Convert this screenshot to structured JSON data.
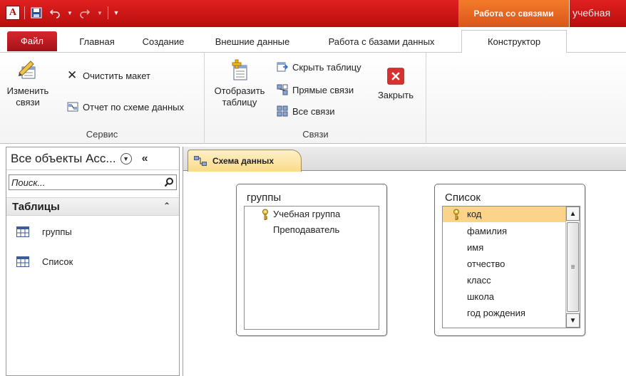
{
  "window": {
    "title": "учебная",
    "context_tab_title": "Работа со связями"
  },
  "ribbon_tabs": [
    {
      "label": "Файл",
      "active": false
    },
    {
      "label": "Главная",
      "active": false
    },
    {
      "label": "Создание",
      "active": false
    },
    {
      "label": "Внешние данные",
      "active": false
    },
    {
      "label": "Работа с базами данных",
      "active": false
    },
    {
      "label": "Конструктор",
      "active": true
    }
  ],
  "ribbon": {
    "service_group": {
      "label": "Сервис",
      "edit_relations": "Изменить связи",
      "clear_layout": "Очистить макет",
      "relations_report": "Отчет по схеме данных"
    },
    "relations_group": {
      "label": "Связи",
      "show_table": "Отобразить таблицу",
      "hide_table": "Скрыть таблицу",
      "direct_relations": "Прямые связи",
      "all_relations": "Все связи",
      "close": "Закрыть"
    }
  },
  "nav": {
    "header": "Все объекты Acc...",
    "search_placeholder": "Поиск...",
    "section": "Таблицы",
    "items": [
      "группы",
      "Список"
    ]
  },
  "document": {
    "tab_label": "Схема данных",
    "tables": [
      {
        "name": "группы",
        "fields": [
          {
            "label": "Учебная группа",
            "key": true
          },
          {
            "label": "Преподаватель",
            "key": false
          }
        ]
      },
      {
        "name": "Список",
        "fields": [
          {
            "label": "код",
            "key": true,
            "selected": true
          },
          {
            "label": "фамилия",
            "key": false
          },
          {
            "label": "имя",
            "key": false
          },
          {
            "label": "отчество",
            "key": false
          },
          {
            "label": "класс",
            "key": false
          },
          {
            "label": "школа",
            "key": false
          },
          {
            "label": "год рождения",
            "key": false
          }
        ]
      }
    ]
  },
  "colors": {
    "title_bar": "#c8121a",
    "context_tab": "#e8672a",
    "doc_tab": "#fbdb88",
    "selected_field": "#fbd48a"
  },
  "icons": [
    "app-icon",
    "save-icon",
    "undo-icon",
    "redo-icon",
    "customize-qat-icon",
    "edit-relations-icon",
    "clear-layout-icon",
    "report-icon",
    "show-table-icon",
    "hide-table-icon",
    "direct-relations-icon",
    "all-relations-icon",
    "close-icon",
    "search-icon",
    "table-icon",
    "key-icon",
    "relationship-diagram-icon"
  ]
}
